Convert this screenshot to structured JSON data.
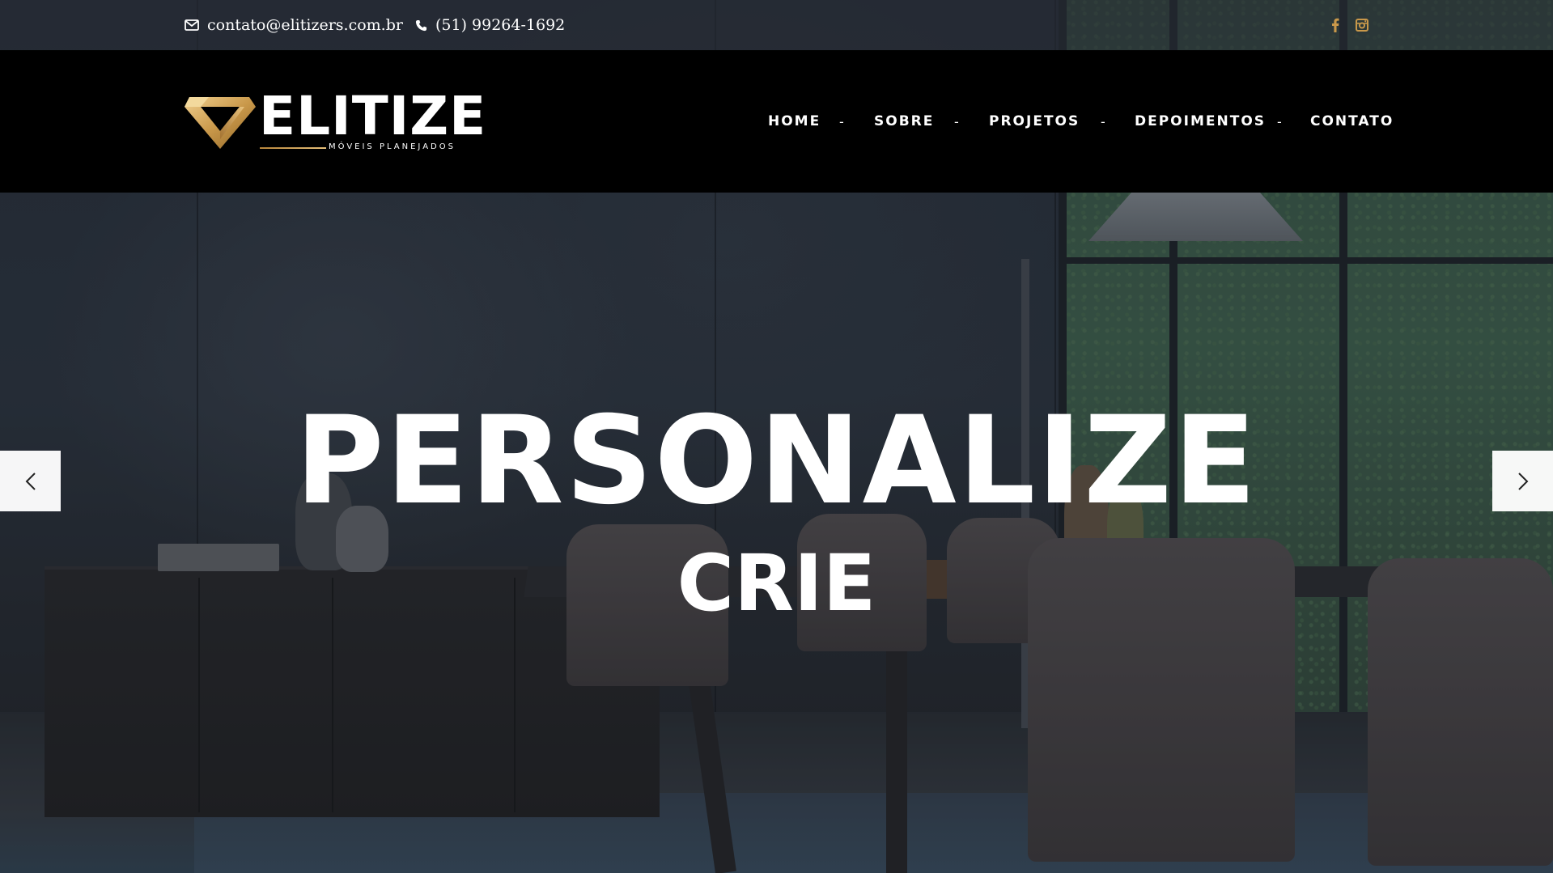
{
  "topbar": {
    "email": "contato@elitizers.com.br",
    "phone": "(51) 99264-1692",
    "email_icon": "envelope-icon",
    "phone_icon": "phone-icon",
    "social": [
      {
        "name": "facebook",
        "icon": "facebook-icon"
      },
      {
        "name": "instagram",
        "icon": "instagram-icon"
      }
    ]
  },
  "brand": {
    "name": "ELITIZE",
    "tagline": "MÓVEIS PLANEJADOS",
    "gold": "#c9984a"
  },
  "nav": {
    "items": [
      {
        "label": "HOME"
      },
      {
        "label": "SOBRE"
      },
      {
        "label": "PROJETOS"
      },
      {
        "label": "DEPOIMENTOS"
      },
      {
        "label": "CONTATO"
      }
    ],
    "separator": "-"
  },
  "hero": {
    "title": "PERSONALIZE",
    "subtitle": "CRIE",
    "prev_icon": "chevron-left-icon",
    "next_icon": "chevron-right-icon"
  },
  "colors": {
    "header_bg": "#000000",
    "text": "#ffffff",
    "social_icon": "#c9984a"
  }
}
